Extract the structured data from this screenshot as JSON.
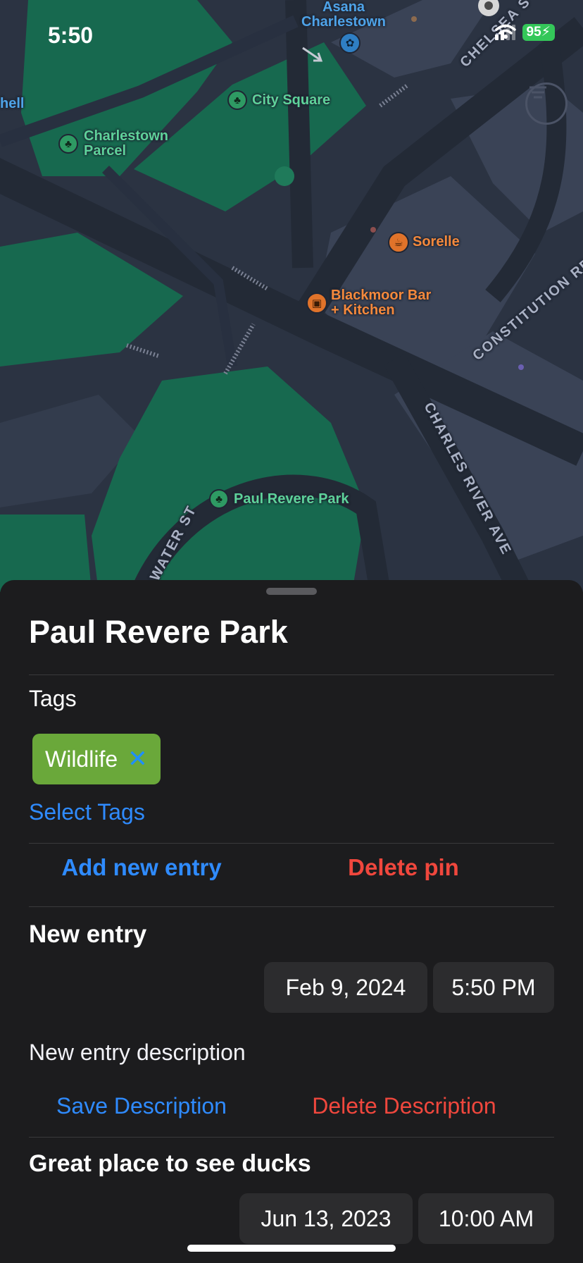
{
  "status_bar": {
    "time": "5:50",
    "battery": "95"
  },
  "map": {
    "labels": {
      "asana": "Asana\nCharlestown",
      "city_square": "City Square",
      "charlestown_parcel": "Charlestown\nParcel",
      "hell_partial": "hell",
      "sorelle": "Sorelle",
      "blackmoor": "Blackmoor Bar\n+ Kitchen",
      "paul_revere_park": "Paul Revere Park",
      "chelsea_st": "CHELSEA S",
      "constitution_rd": "CONSTITUTION RD",
      "charles_river_ave": "CHARLES RIVER AVE",
      "water_st": "WATER ST"
    },
    "colors": {
      "land": "#2b3342",
      "road": "#232a36",
      "park": "#17694f",
      "block": "#3a4356"
    }
  },
  "sheet": {
    "title": "Paul Revere Park",
    "tags_label": "Tags",
    "tags": [
      {
        "label": "Wildlife",
        "color": "#6aa83a"
      }
    ],
    "select_tags": "Select Tags",
    "add_entry": "Add new entry",
    "delete_pin": "Delete pin",
    "new_entry": {
      "heading": "New entry",
      "date": "Feb 9, 2024",
      "time": "5:50 PM",
      "description_placeholder": "New entry description",
      "save": "Save Description",
      "delete": "Delete Description"
    },
    "entries": [
      {
        "description": "Great place to see ducks",
        "date": "Jun 13, 2023",
        "time": "10:00 AM"
      }
    ]
  }
}
